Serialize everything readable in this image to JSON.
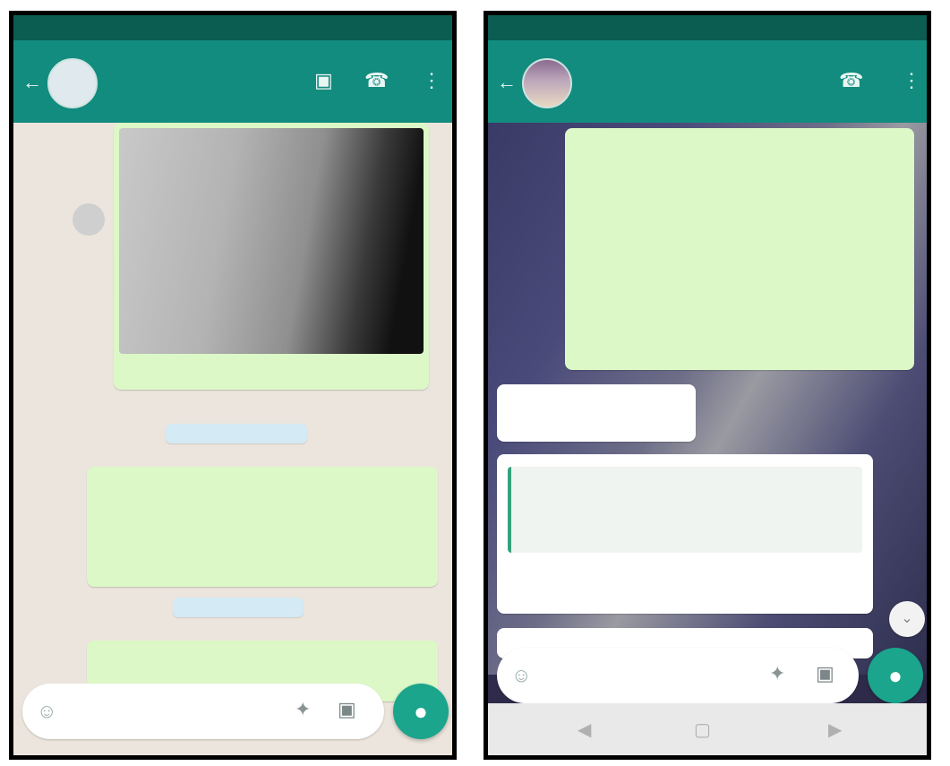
{
  "left": {
    "status": {
      "time": "",
      "right": ""
    },
    "header": {
      "title": "",
      "subtitle": ""
    },
    "date_chip_1": "",
    "date_chip_2": "",
    "message_1": {
      "text": "",
      "time": ""
    },
    "message_2": {
      "text": "",
      "time": ""
    },
    "image_message": {
      "time": ""
    },
    "input": {
      "placeholder": ""
    }
  },
  "right": {
    "status": {
      "time": "",
      "right": ""
    },
    "header": {
      "title": "",
      "subtitle": ""
    },
    "message_1": {
      "text": "",
      "time": ""
    },
    "reply_1": {
      "sender": "",
      "text": "",
      "time": ""
    },
    "reply_2": {
      "sender": "",
      "quote_sender": "",
      "quote_text": "",
      "text": "",
      "time": ""
    },
    "reply_3": {
      "sender": ""
    },
    "input": {
      "placeholder": ""
    }
  },
  "icons": {
    "back": "arrow-left-icon",
    "video": "video-call-icon",
    "call": "call-icon",
    "menu": "menu-dots-icon",
    "emoji": "emoji-icon",
    "attach": "attach-icon",
    "camera": "camera-icon",
    "mic": "mic-icon",
    "scroll_down": "chevron-down-icon"
  },
  "colors": {
    "header": "#128c7e",
    "status": "#0b5c51",
    "outgoing": "#dcf8c6",
    "incoming": "#ffffff",
    "fab": "#1aa58c"
  }
}
